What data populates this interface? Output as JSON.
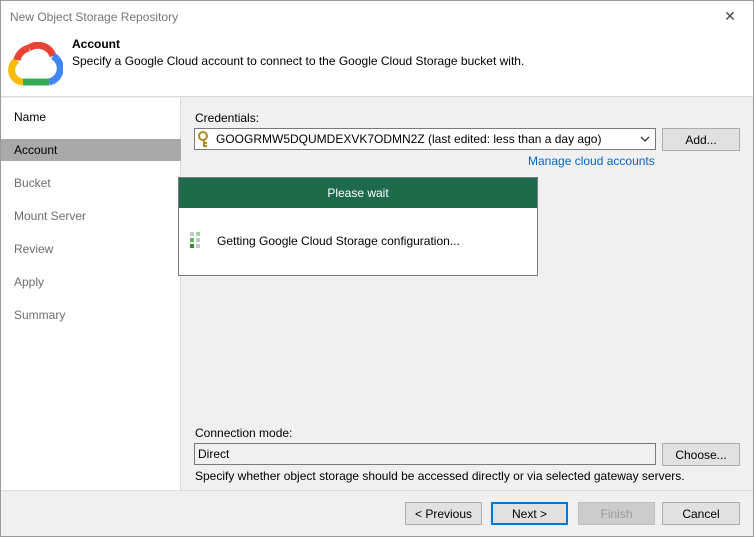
{
  "window": {
    "title": "New Object Storage Repository",
    "close_glyph": "✕"
  },
  "header": {
    "title": "Account",
    "subtitle": "Specify a Google Cloud account to connect to the Google Cloud Storage bucket with.",
    "logo_icon": "google-cloud-logo"
  },
  "sidebar": {
    "items": [
      {
        "label": "Name",
        "state": "done"
      },
      {
        "label": "Account",
        "state": "active"
      },
      {
        "label": "Bucket",
        "state": "pending"
      },
      {
        "label": "Mount Server",
        "state": "pending"
      },
      {
        "label": "Review",
        "state": "pending"
      },
      {
        "label": "Apply",
        "state": "pending"
      },
      {
        "label": "Summary",
        "state": "pending"
      }
    ]
  },
  "account": {
    "credentials_label": "Credentials:",
    "credentials_value": "GOOGRMW5DQUMDEXVK7ODMN2Z (last edited: less than a day ago)",
    "add_label": "Add...",
    "manage_link": "Manage cloud accounts",
    "connection_mode_label": "Connection mode:",
    "connection_mode_value": "Direct",
    "choose_label": "Choose...",
    "connection_hint": "Specify whether object storage should be accessed directly or via selected gateway servers."
  },
  "wait_dialog": {
    "title": "Please wait",
    "message": "Getting Google Cloud Storage configuration...",
    "header_color": "#1d6b4b"
  },
  "footer": {
    "previous_label": "< Previous",
    "next_label": "Next >",
    "finish_label": "Finish",
    "cancel_label": "Cancel"
  },
  "colors": {
    "accent_link": "#0066cc",
    "active_step": "#a9a9a9",
    "focus_border": "#0078d7"
  }
}
